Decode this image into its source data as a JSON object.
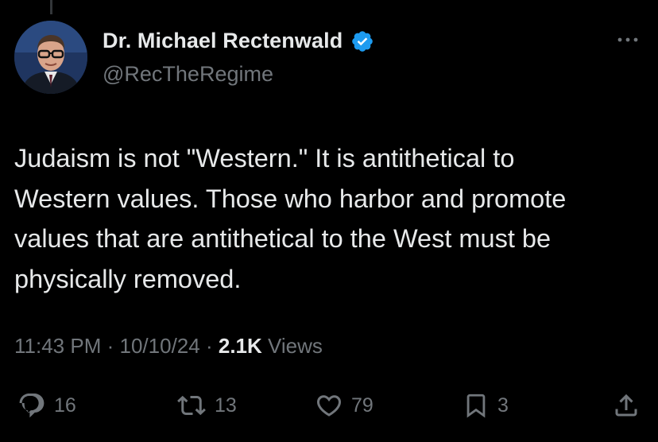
{
  "author": {
    "display_name": "Dr. Michael Rectenwald",
    "handle": "@RecTheRegime",
    "verified": true,
    "avatar_icon": "profile-photo"
  },
  "tweet": {
    "text": "Judaism is not \"Western.\" It is antithetical to\nWestern values. Those who harbor and promote\nvalues that are antithetical to the West must be\nphysically removed."
  },
  "meta": {
    "time": "11:43 PM",
    "sep1": "·",
    "date": "10/10/24",
    "sep2": "·",
    "views_count": "2.1K",
    "views_label": "Views"
  },
  "actions": {
    "replies": "16",
    "reposts": "13",
    "likes": "79",
    "bookmarks": "3"
  },
  "colors": {
    "background": "#000000",
    "text_primary": "#e7e9ea",
    "text_secondary": "#71767b",
    "verified_blue": "#1d9bf0"
  },
  "icons": {
    "more": "more-horizontal-icon",
    "verified": "verified-badge-icon",
    "reply": "reply-bubble-icon",
    "repost": "repost-arrows-icon",
    "like": "heart-icon",
    "bookmark": "bookmark-icon",
    "share": "share-icon"
  }
}
